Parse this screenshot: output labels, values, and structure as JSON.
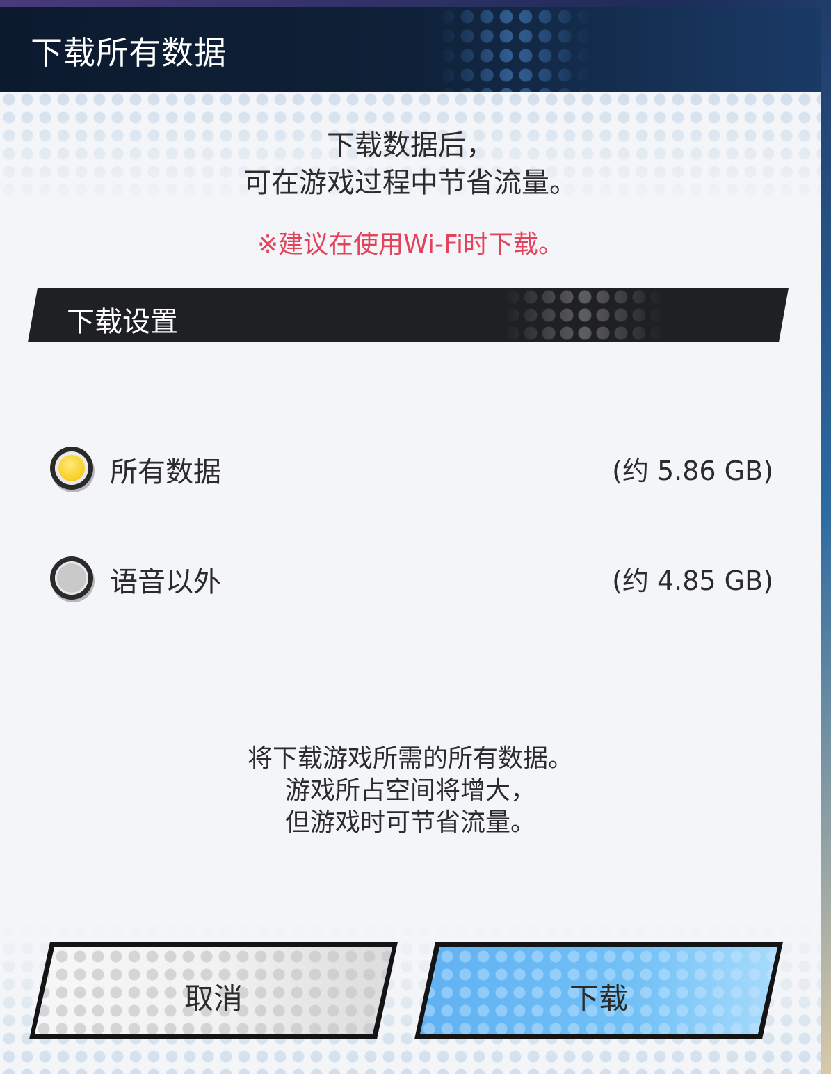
{
  "dialog": {
    "title": "下载所有数据",
    "intro_line1": "下载数据后，",
    "intro_line2": "可在游戏过程中节省流量。",
    "warning": "※建议在使用Wi-Fi时下载。",
    "section_title": "下载设置",
    "options": [
      {
        "label": "所有数据",
        "size": "(约 5.86 GB)",
        "selected": true
      },
      {
        "label": "语音以外",
        "size": "(约 4.85 GB)",
        "selected": false
      }
    ],
    "description_line1": "将下载游戏所需的所有数据。",
    "description_line2": "游戏所占空间将增大，",
    "description_line3": "但游戏时可节省流量。",
    "cancel_label": "取消",
    "download_label": "下载"
  },
  "colors": {
    "header_bg": "#0c1a2e",
    "warning_text": "#e3425a",
    "selected_radio": "#f4c810",
    "download_button": "#5fb1f2"
  }
}
